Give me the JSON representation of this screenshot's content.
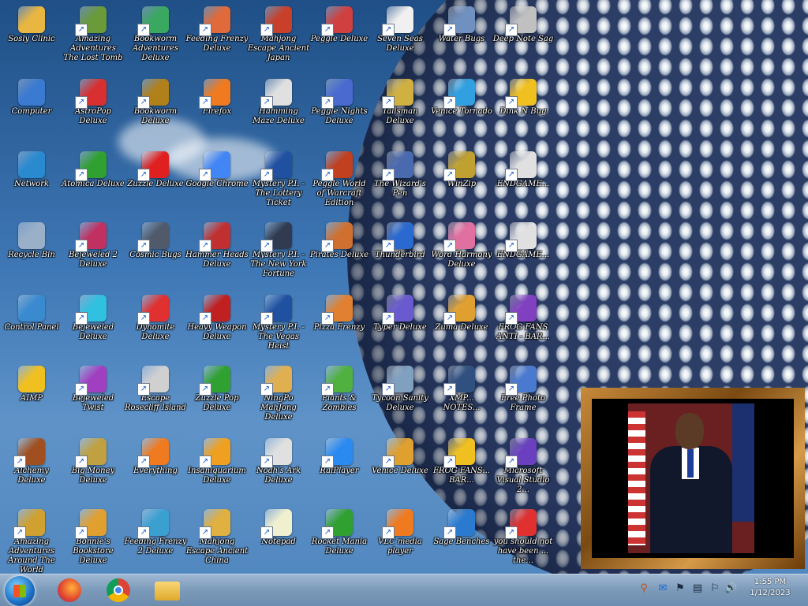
{
  "desktop": {
    "icons": [
      {
        "label": "Sosly Clinic",
        "color": "#e9b741",
        "shortcut": false
      },
      {
        "label": "Amazing Adventures The Lost Tomb",
        "color": "#6a9a3a",
        "shortcut": true
      },
      {
        "label": "Bookworm Adventures Deluxe",
        "color": "#3aa860",
        "shortcut": true
      },
      {
        "label": "Feeding Frenzy Deluxe",
        "color": "#e06a3a",
        "shortcut": true
      },
      {
        "label": "Mahjong Escape Ancient Japan",
        "color": "#c8402a",
        "shortcut": true
      },
      {
        "label": "Peggle Deluxe",
        "color": "#d04040",
        "shortcut": true
      },
      {
        "label": "Seven Seas Deluxe",
        "color": "#f0f0f0",
        "shortcut": true
      },
      {
        "label": "Water Bugs",
        "color": "#7090c0",
        "shortcut": true
      },
      {
        "label": "Deep Note Sag",
        "color": "#c0c0c0",
        "shortcut": true
      },
      {
        "label": "Computer",
        "color": "#3a7ad0",
        "shortcut": false
      },
      {
        "label": "AstroPop Deluxe",
        "color": "#d83030",
        "shortcut": true
      },
      {
        "label": "Bookworm Deluxe",
        "color": "#b0801a",
        "shortcut": true
      },
      {
        "label": "Firefox",
        "color": "#f07a20",
        "shortcut": true
      },
      {
        "label": "Hamming Maze Deluxe",
        "color": "#e0e0e0",
        "shortcut": true
      },
      {
        "label": "Peggle Nights Deluxe",
        "color": "#4a6ad0",
        "shortcut": true
      },
      {
        "label": "Talisman Deluxe",
        "color": "#d0b040",
        "shortcut": true
      },
      {
        "label": "Venice Tornado",
        "color": "#30a0e0",
        "shortcut": true
      },
      {
        "label": "Dink N Bug",
        "color": "#f0c020",
        "shortcut": true
      },
      {
        "label": "Network",
        "color": "#2a8ad0",
        "shortcut": false
      },
      {
        "label": "Atomica Deluxe",
        "color": "#30a030",
        "shortcut": true
      },
      {
        "label": "Zuzzle Deluxe",
        "color": "#e02020",
        "shortcut": true
      },
      {
        "label": "Google Chrome",
        "color": "#4285f4",
        "shortcut": true
      },
      {
        "label": "Mystery P.I. - The Lottery Ticket",
        "color": "#2050a0",
        "shortcut": true
      },
      {
        "label": "Peggle World of Warcraft Edition",
        "color": "#c04020",
        "shortcut": true
      },
      {
        "label": "The Wizard's Pen",
        "color": "#4a6ab0",
        "shortcut": true
      },
      {
        "label": "WinZip",
        "color": "#c0a030",
        "shortcut": true
      },
      {
        "label": "ENDGAME...",
        "color": "#e0e0e0",
        "shortcut": true
      },
      {
        "label": "Recycle Bin",
        "color": "#9ab0c8",
        "shortcut": false
      },
      {
        "label": "Bejeweled 2 Deluxe",
        "color": "#c03060",
        "shortcut": true
      },
      {
        "label": "Cosmic Bugs",
        "color": "#505a6a",
        "shortcut": true
      },
      {
        "label": "Hammer Heads Deluxe",
        "color": "#c03030",
        "shortcut": true
      },
      {
        "label": "Mystery P.I. - The New York Fortune",
        "color": "#303a50",
        "shortcut": true
      },
      {
        "label": "Pirates Deluxe",
        "color": "#d07030",
        "shortcut": true
      },
      {
        "label": "Thunderbird",
        "color": "#2a6ad0",
        "shortcut": true
      },
      {
        "label": "Word Harmony Deluxe",
        "color": "#e070a0",
        "shortcut": true
      },
      {
        "label": "ENDGAME...",
        "color": "#e0e0e0",
        "shortcut": true
      },
      {
        "label": "Control Panel",
        "color": "#3a8ad0",
        "shortcut": false
      },
      {
        "label": "Bejeweled Deluxe",
        "color": "#30c0e0",
        "shortcut": true
      },
      {
        "label": "Dynomite Deluxe",
        "color": "#e03030",
        "shortcut": true
      },
      {
        "label": "Heavy Weapon Deluxe",
        "color": "#c02020",
        "shortcut": true
      },
      {
        "label": "Mystery P.I. - The Vegas Heist",
        "color": "#2050a0",
        "shortcut": true
      },
      {
        "label": "Pizza Frenzy",
        "color": "#e08030",
        "shortcut": true
      },
      {
        "label": "Typer Deluxe",
        "color": "#6a5ad0",
        "shortcut": true
      },
      {
        "label": "Zuma Deluxe",
        "color": "#e0a030",
        "shortcut": true
      },
      {
        "label": "FROG FANS ANTI - BAR...",
        "color": "#8040c0",
        "shortcut": true
      },
      {
        "label": "AIMP",
        "color": "#f0c020",
        "shortcut": false
      },
      {
        "label": "Bejeweled Twist",
        "color": "#a040c0",
        "shortcut": true
      },
      {
        "label": "Escape Rosecliff Island",
        "color": "#d0d0d0",
        "shortcut": true
      },
      {
        "label": "Zuzzle Pop Deluxe",
        "color": "#30a030",
        "shortcut": true
      },
      {
        "label": "NingPo MahJong Deluxe",
        "color": "#e0b050",
        "shortcut": true
      },
      {
        "label": "Plants & Zombies",
        "color": "#50b040",
        "shortcut": true
      },
      {
        "label": "Tycoon Sanity Deluxe",
        "color": "#80a0c0",
        "shortcut": true
      },
      {
        "label": "XMP... NOTES...",
        "color": "#305080",
        "shortcut": true
      },
      {
        "label": "Free Photo Frame",
        "color": "#4a7ad0",
        "shortcut": true
      },
      {
        "label": "Alchemy Deluxe",
        "color": "#a05020",
        "shortcut": true
      },
      {
        "label": "Big Money Deluxe",
        "color": "#c0a040",
        "shortcut": true
      },
      {
        "label": "Everything",
        "color": "#f07a20",
        "shortcut": true
      },
      {
        "label": "Insaniquarium Deluxe",
        "color": "#f0a020",
        "shortcut": true
      },
      {
        "label": "Noah's Ark Deluxe",
        "color": "#e0e0e0",
        "shortcut": true
      },
      {
        "label": "RaiPlayer",
        "color": "#2a8af0",
        "shortcut": true
      },
      {
        "label": "Venice Deluxe",
        "color": "#e0a030",
        "shortcut": true
      },
      {
        "label": "FROG FANS... BAR...",
        "color": "#f0c020",
        "shortcut": true
      },
      {
        "label": "Microsoft Visual Studio 2...",
        "color": "#6a40c0",
        "shortcut": true
      },
      {
        "label": "Amazing Adventures Around The World",
        "color": "#d0a030",
        "shortcut": true
      },
      {
        "label": "Bonnie's Bookstore Deluxe",
        "color": "#e0a030",
        "shortcut": true
      },
      {
        "label": "Feeding Frenzy 2 Deluxe",
        "color": "#3aa0d0",
        "shortcut": true
      },
      {
        "label": "Mahjong Escape Ancient China",
        "color": "#e0b040",
        "shortcut": true
      },
      {
        "label": "Notepad",
        "color": "#f0f0d0",
        "shortcut": true
      },
      {
        "label": "Rocket Mania Deluxe",
        "color": "#30a030",
        "shortcut": true
      },
      {
        "label": "VLC media player",
        "color": "#f07a20",
        "shortcut": true
      },
      {
        "label": "Sage Benches",
        "color": "#2a7ad0",
        "shortcut": true
      },
      {
        "label": "you should not have been ... the...",
        "color": "#e03030",
        "shortcut": true
      }
    ]
  },
  "taskbar": {
    "start_label": "Start",
    "pinned": [
      {
        "name": "Firefox"
      },
      {
        "name": "Google Chrome"
      },
      {
        "name": "File Explorer"
      }
    ],
    "tray_icons": [
      "search-icon",
      "chat-icon",
      "network-icon",
      "monitor-icon",
      "flag-icon",
      "volume-icon"
    ],
    "time": "1:55 PM",
    "date": "1/12/2023"
  }
}
